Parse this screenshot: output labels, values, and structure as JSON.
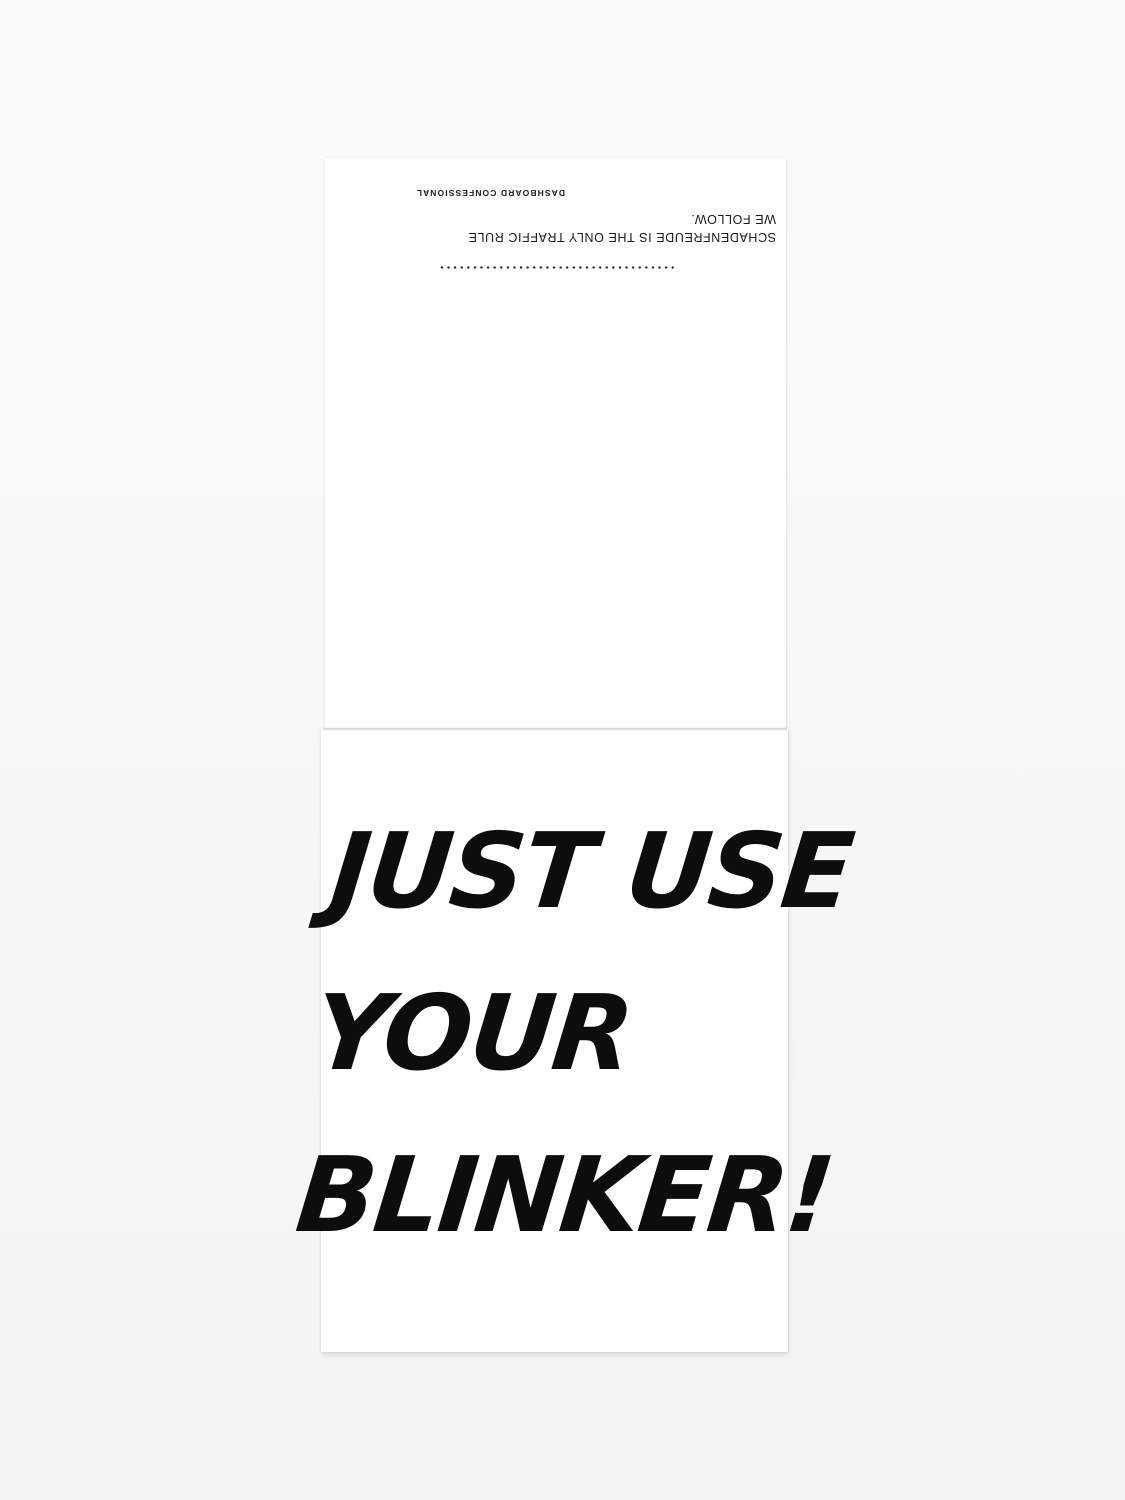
{
  "card_back": {
    "quote_line_1": "SCHADENFREUDE IS THE ONLY TRAFFIC RULE",
    "quote_line_2": "WE FOLLOW.",
    "brand": "DASHBOARD CONFESSIONAL"
  },
  "card_front": {
    "line_1": "JUST USE",
    "line_2": "YOUR",
    "line_3": "BLINKER!"
  },
  "colors": {
    "ink": "#0d0d0d",
    "paper": "#ffffff",
    "background": "#f7f7f7"
  }
}
